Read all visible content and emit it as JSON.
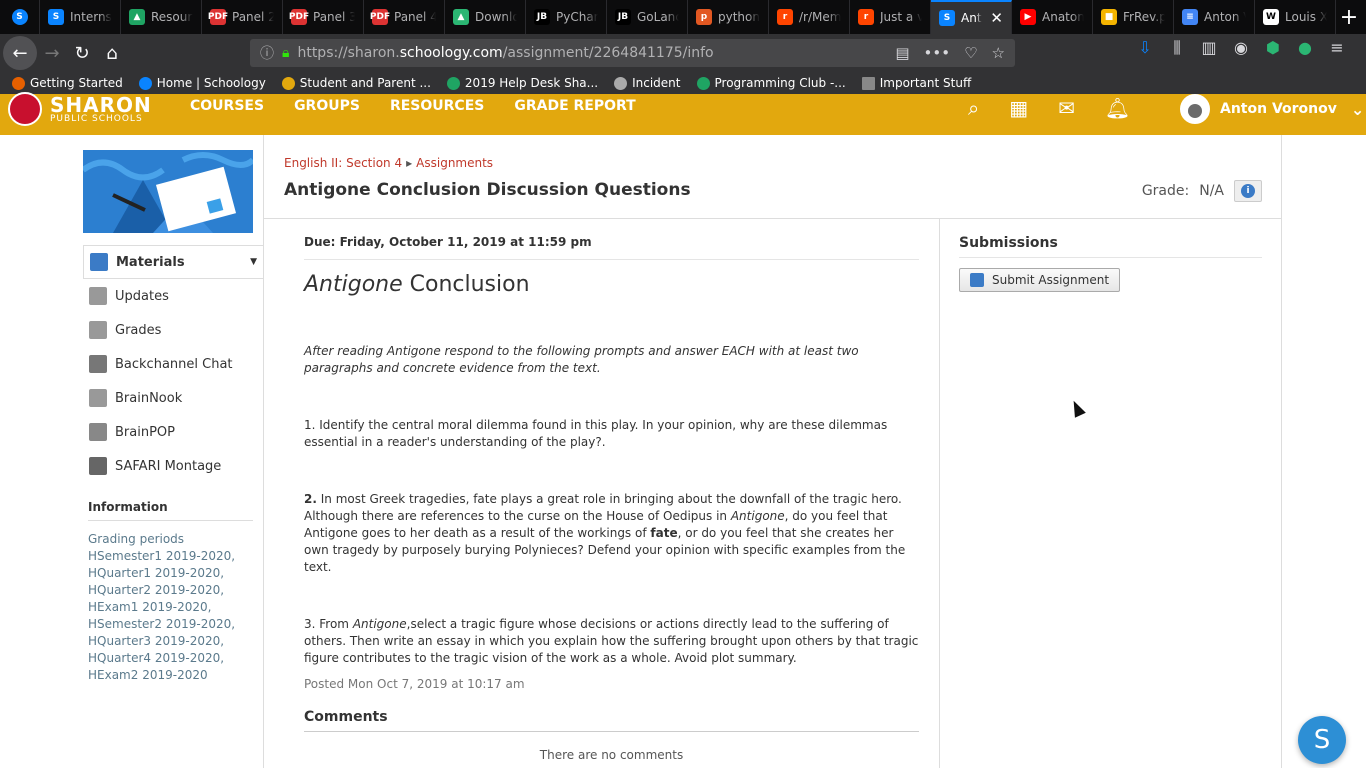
{
  "browser": {
    "tabs": [
      {
        "title": "Interns",
        "color": "#0a84ff",
        "glyph": "S"
      },
      {
        "title": "Resour",
        "color": "#1fa463",
        "glyph": "▲"
      },
      {
        "title": "Panel 2",
        "color": "#d33",
        "glyph": "PDF"
      },
      {
        "title": "Panel 3",
        "color": "#d33",
        "glyph": "PDF"
      },
      {
        "title": "Panel 4",
        "color": "#d33",
        "glyph": "PDF"
      },
      {
        "title": "Downlo",
        "color": "#2bb673",
        "glyph": "▲"
      },
      {
        "title": "PyChar",
        "color": "#000",
        "glyph": "JB"
      },
      {
        "title": "GoLanc",
        "color": "#000",
        "glyph": "JB"
      },
      {
        "title": "python",
        "color": "#e25822",
        "glyph": "p"
      },
      {
        "title": "/r/Mem",
        "color": "#ff4500",
        "glyph": "r"
      },
      {
        "title": "Just a v",
        "color": "#ff4500",
        "glyph": "r"
      },
      {
        "title": "Anti",
        "color": "#0a84ff",
        "glyph": "S",
        "active": true
      },
      {
        "title": "Anaton",
        "color": "#f00",
        "glyph": "▶"
      },
      {
        "title": "FrRev.p",
        "color": "#f4b400",
        "glyph": "■"
      },
      {
        "title": "Anton V",
        "color": "#4285f4",
        "glyph": "≡"
      },
      {
        "title": "Louis X",
        "color": "#fff",
        "glyph": "W"
      }
    ],
    "url_prefix": "https://sharon.",
    "url_host": "schoology.com",
    "url_path": "/assignment/2264841175/info",
    "bookmarks": [
      {
        "label": "Getting Started",
        "color": "#e66000"
      },
      {
        "label": "Home | Schoology",
        "color": "#0a84ff"
      },
      {
        "label": "Student and Parent ...",
        "color": "#e2a80e"
      },
      {
        "label": "2019 Help Desk Sha...",
        "color": "#1fa463"
      },
      {
        "label": "Incident",
        "color": "#aaa"
      },
      {
        "label": "Programming Club -...",
        "color": "#1fa463"
      },
      {
        "label": "Important Stuff",
        "color": "#888"
      }
    ]
  },
  "site": {
    "logo_line1": "SHARON",
    "logo_line2": "PUBLIC SCHOOLS",
    "nav": [
      "COURSES",
      "GROUPS",
      "RESOURCES",
      "GRADE REPORT"
    ],
    "user_name": "Anton Voronov",
    "header_color": "#e2a80e"
  },
  "sidebar": {
    "items": [
      {
        "label": "Materials",
        "active": true
      },
      {
        "label": "Updates"
      },
      {
        "label": "Grades"
      },
      {
        "label": "Backchannel Chat"
      },
      {
        "label": "BrainNook"
      },
      {
        "label": "BrainPOP"
      },
      {
        "label": "SAFARI Montage"
      }
    ],
    "info_title": "Information",
    "grading_label": "Grading periods",
    "grading_periods": [
      "HSemester1 2019-2020,",
      "HQuarter1 2019-2020,",
      "HQuarter2 2019-2020,",
      "HExam1 2019-2020,",
      "HSemester2 2019-2020,",
      "HQuarter3 2019-2020,",
      "HQuarter4 2019-2020,",
      "HExam2 2019-2020"
    ]
  },
  "main": {
    "crumb_course": "English II: Section 4",
    "crumb_sep": "▸",
    "crumb_page": "Assignments",
    "title": "Antigone Conclusion Discussion Questions",
    "grade_label": "Grade:",
    "grade_value": "N/A",
    "due": "Due: Friday, October 11, 2019 at 11:59 pm",
    "heading_em": "Antigone",
    "heading_rest": " Conclusion",
    "intro": "After reading Antigone respond to the following prompts and answer EACH with at least two paragraphs and concrete evidence from the text.",
    "q1_num": "1.",
    "q1": " Identify the central moral dilemma found in this play. In your opinion, why are these dilemmas essential in a reader's understanding of the play?.",
    "q2_num": "2.",
    "q2_a": " In most Greek tragedies, fate plays a great role in bringing about the downfall of the tragic hero. Although there are references to the curse on the House of Oedipus in ",
    "q2_em": "Antigone",
    "q2_b": ", do you feel that Antigone goes to her death as a result of the workings of ",
    "q2_strong": "fate",
    "q2_c": ", or do you feel that she creates her own tragedy by purposely burying Polynieces? Defend your opinion with specific examples from the text.",
    "q3_a": "3. From ",
    "q3_em": "Antigone",
    "q3_b": ",select a tragic figure whose decisions or actions directly lead to the suffering of others.  Then write an essay in which you explain how the suffering brought upon others by that tragic figure contributes to the tragic vision of the work as a whole.  Avoid plot summary.",
    "posted": "Posted Mon Oct 7, 2019 at 10:17 am",
    "comments_title": "Comments",
    "no_comments": "There are no comments",
    "submissions_title": "Submissions",
    "submit_label": "Submit Assignment"
  },
  "fab_letter": "S"
}
